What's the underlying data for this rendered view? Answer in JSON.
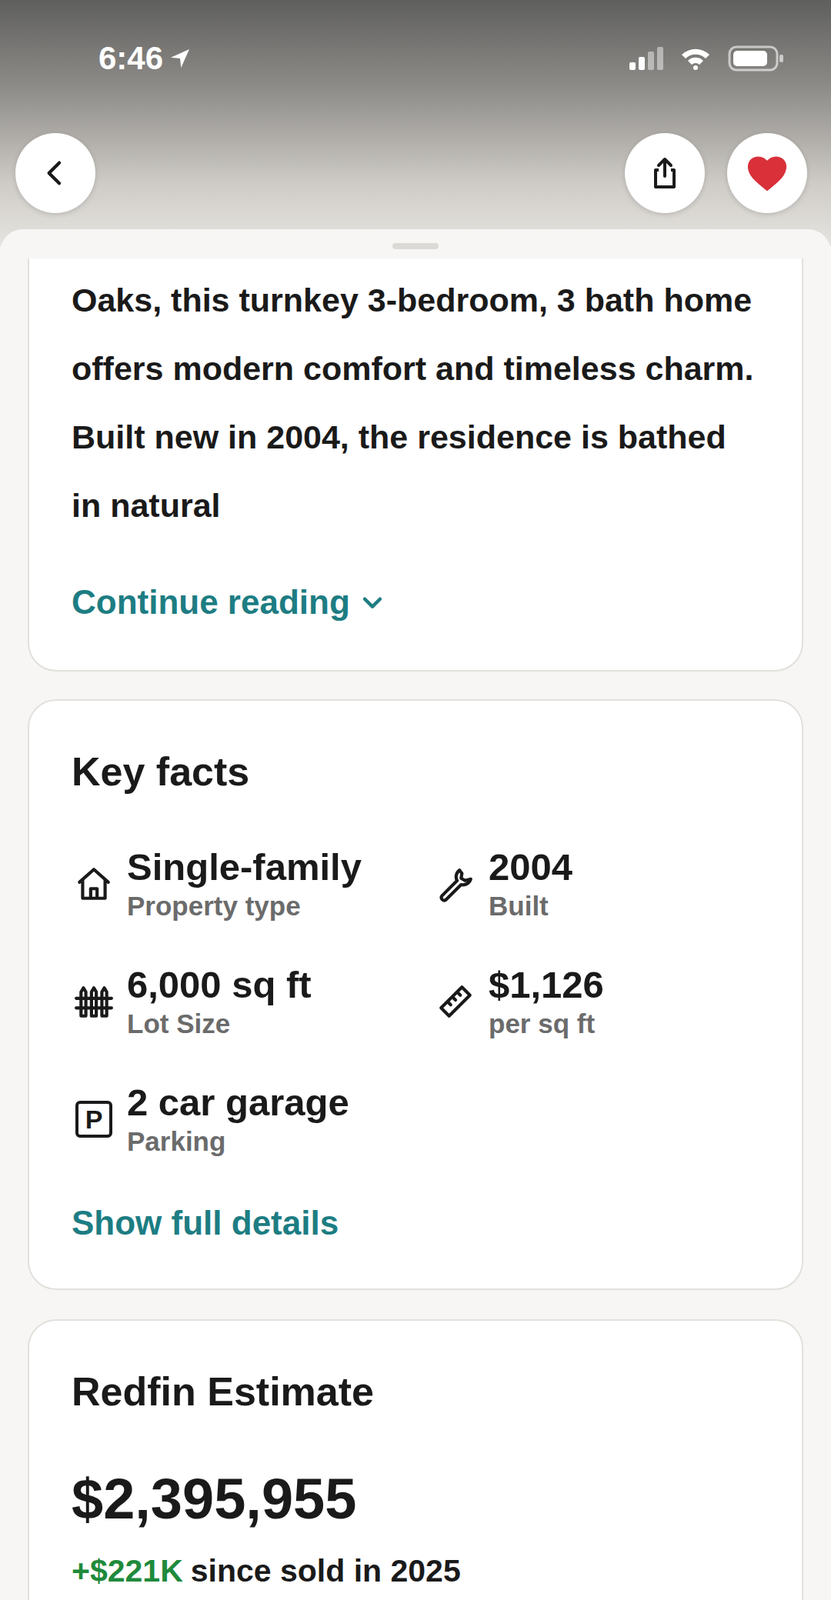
{
  "status_bar": {
    "time": "6:46"
  },
  "header": {
    "favorited": true
  },
  "description": {
    "text": "Oaks, this turnkey 3-bedroom, 3 bath home offers modern comfort and timeless charm. Built new in 2004, the residence is bathed in natural",
    "link": "Continue reading"
  },
  "key_facts": {
    "title": "Key facts",
    "items": [
      {
        "value": "Single-family",
        "label": "Property type"
      },
      {
        "value": "2004",
        "label": "Built"
      },
      {
        "value": "6,000 sq ft",
        "label": "Lot Size"
      },
      {
        "value": "$1,126",
        "label": "per sq ft"
      },
      {
        "value": "2 car garage",
        "label": "Parking",
        "badge": "P"
      }
    ],
    "link": "Show full details"
  },
  "estimate": {
    "title": "Redfin Estimate",
    "value": "$2,395,955",
    "change": "+$221K",
    "change_text": "since sold in 2025"
  }
}
